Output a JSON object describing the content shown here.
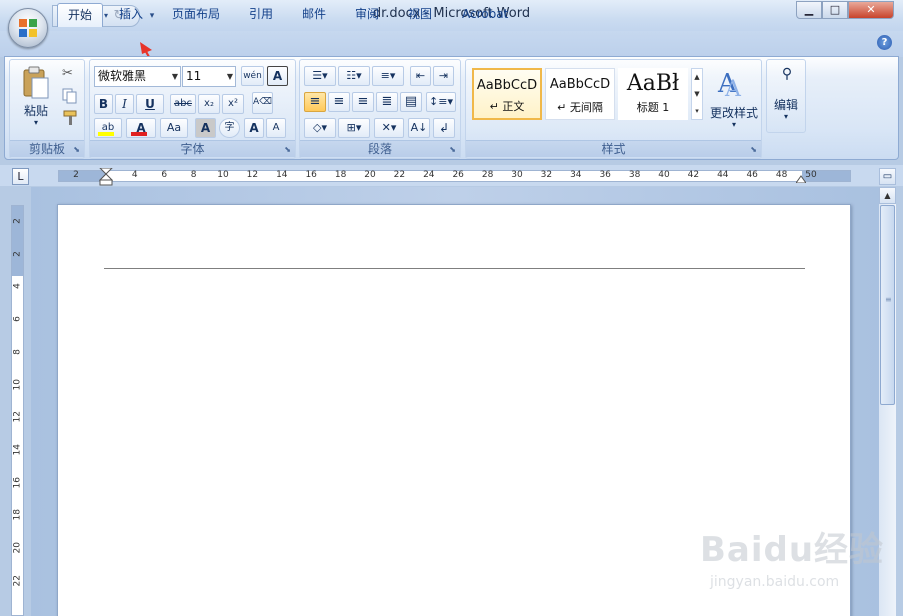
{
  "window": {
    "title": "dr.docx - Microsoft Word",
    "min_glyph": "▁",
    "max_glyph": "□",
    "close_glyph": "✕"
  },
  "qat": {
    "save_icon": "floppy-disk-icon",
    "undo_icon": "undo-icon",
    "redo_icon": "redo-icon",
    "customize_icon": "customize-qat-icon"
  },
  "tabs": [
    {
      "label": "开始",
      "active": true
    },
    {
      "label": "插入",
      "active": false
    },
    {
      "label": "页面布局",
      "active": false
    },
    {
      "label": "引用",
      "active": false
    },
    {
      "label": "邮件",
      "active": false
    },
    {
      "label": "审阅",
      "active": false
    },
    {
      "label": "视图",
      "active": false
    },
    {
      "label": "Acrobat",
      "active": false
    }
  ],
  "help_label": "?",
  "ribbon": {
    "clipboard": {
      "label": "剪贴板",
      "paste_label": "粘贴",
      "paste_caret": "▾"
    },
    "font": {
      "label": "字体",
      "font_name": "微软雅黑",
      "font_size": "11",
      "bold": "B",
      "italic": "I",
      "underline": "U",
      "strike": "abc",
      "subscript": "x₂",
      "superscript": "x²",
      "grow": "A",
      "shrink": "A",
      "case": "Aa",
      "phonetic": "wén",
      "border_a": "A",
      "char_shading": "A",
      "enclose": "字",
      "highlight": "ab",
      "font_color": "A"
    },
    "paragraph": {
      "label": "段落"
    },
    "styles": {
      "label": "样式",
      "items": [
        {
          "sample": "AaBbCcD",
          "name": "↵ 正文",
          "selected": true
        },
        {
          "sample": "AaBbCcD",
          "name": "↵ 无间隔",
          "selected": false
        },
        {
          "sample": "AaBł",
          "name": "标题 1",
          "selected": false
        }
      ],
      "change_styles_label": "更改样式"
    },
    "editing": {
      "label": "编辑"
    }
  },
  "ruler": {
    "corner": "L",
    "h_numbers": [
      "2",
      "2",
      "4",
      "6",
      "8",
      "10",
      "12",
      "14",
      "16",
      "18",
      "20",
      "22",
      "24",
      "26",
      "28",
      "30",
      "32",
      "34",
      "36",
      "38",
      "40",
      "42",
      "44",
      "46",
      "48",
      "50"
    ],
    "v_numbers": [
      "2",
      "2",
      "4",
      "6",
      "8",
      "10",
      "12",
      "14",
      "16",
      "18",
      "20",
      "22"
    ]
  },
  "watermark": {
    "text": "Baidu经验",
    "sub": "jingyan.baidu.com"
  },
  "colors": {
    "accent": "#f0b84a",
    "font_color_bar": "#e02020",
    "highlight_bar": "#ffff00",
    "annotation_arrow": "#e8342a"
  }
}
